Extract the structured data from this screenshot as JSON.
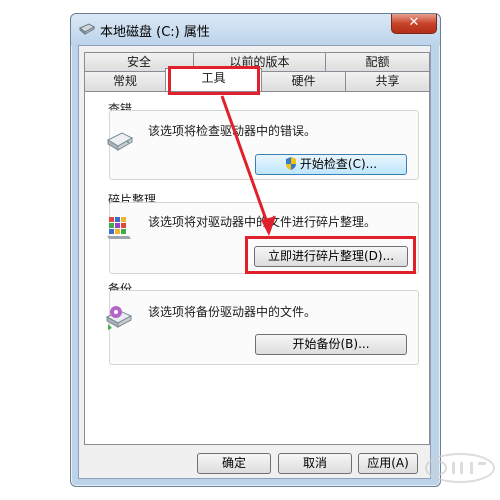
{
  "window": {
    "title": "本地磁盘 (C:) 属性",
    "close_glyph": "✕"
  },
  "tabs_row1": [
    {
      "label": "安全"
    },
    {
      "label": "以前的版本"
    },
    {
      "label": "配额"
    }
  ],
  "tabs_row2": [
    {
      "label": "常规"
    },
    {
      "label": "工具"
    },
    {
      "label": "硬件"
    },
    {
      "label": "共享"
    }
  ],
  "active_tab": "工具",
  "groups": {
    "error_check": {
      "title": "查错",
      "description": "该选项将检查驱动器中的错误。",
      "button": "开始检查(C)...",
      "icon": "drive-icon"
    },
    "defrag": {
      "title": "碎片整理",
      "description": "该选项将对驱动器中的文件进行碎片整理。",
      "button": "立即进行碎片整理(D)...",
      "icon": "defrag-icon"
    },
    "backup": {
      "title": "备份",
      "description": "该选项将备份驱动器中的文件。",
      "button": "开始备份(B)...",
      "icon": "backup-icon"
    }
  },
  "footer": {
    "ok": "确定",
    "cancel": "取消",
    "apply": "应用(A)"
  },
  "colors": {
    "highlight": "#e0202a",
    "window_frame": "#bcd3ea"
  }
}
